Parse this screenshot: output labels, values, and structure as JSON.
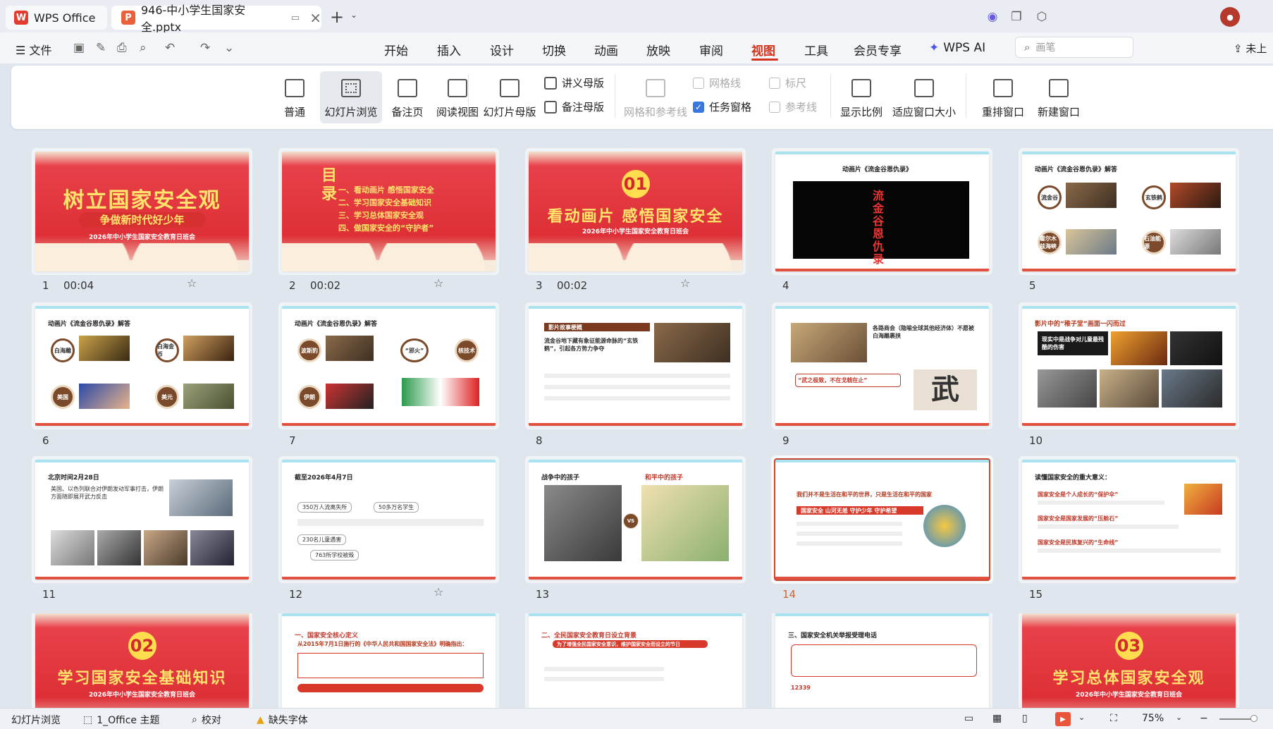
{
  "titlebar": {
    "home_tab": "WPS Office",
    "doc_tab": "946-中小学生国家安全.pptx"
  },
  "menubar": {
    "file": "文件",
    "tabs": [
      "开始",
      "插入",
      "设计",
      "切换",
      "动画",
      "放映",
      "审阅",
      "视图",
      "工具",
      "会员专享"
    ],
    "active_tab": "视图",
    "wps_ai": "WPS AI",
    "search_placeholder": "画笔",
    "cloud": "未上"
  },
  "ribbon": {
    "normal": "普通",
    "slide_sorter": "幻灯片浏览",
    "notes_page": "备注页",
    "reading_view": "阅读视图",
    "slide_master": "幻灯片母版",
    "handout_master": "讲义母版",
    "notes_master": "备注母版",
    "grid_guides": "网格和参考线",
    "gridlines": "网格线",
    "ruler": "标尺",
    "task_pane": "任务窗格",
    "guides": "参考线",
    "zoom": "显示比例",
    "fit_window": "适应窗口大小",
    "arrange": "重排窗口",
    "new_window": "新建窗口"
  },
  "slides": [
    {
      "n": "1",
      "time": "00:04",
      "title": "树立国家安全观",
      "subtitle": "争做新时代好少年",
      "caption": "2026年中小学生国家安全教育日班会"
    },
    {
      "n": "2",
      "time": "00:02",
      "big": "目录",
      "items": [
        "一、看动画片 感悟国家安全",
        "二、学习国家安全基础知识",
        "三、学习总体国家安全观",
        "四、做国家安全的“守护者”"
      ]
    },
    {
      "n": "3",
      "time": "00:02",
      "num": "01",
      "title": "看动画片 感悟国家安全",
      "caption": "2026年中小学生国家安全教育日班会"
    },
    {
      "n": "4",
      "title": "动画片《流金谷恩仇录》",
      "label": "流金谷恩仇录"
    },
    {
      "n": "5",
      "title": "动画片《流金谷恩仇录》解答",
      "c1": "流金谷",
      "c2": "霍尔木兹海峡",
      "c3": "玄铁鹤",
      "c4": "石油能源"
    },
    {
      "n": "6",
      "title": "动画片《流金谷恩仇录》解答",
      "c1": "白海雕",
      "c2": "美国",
      "c3": "白海金币",
      "c4": "美元"
    },
    {
      "n": "7",
      "title": "动画片《流金谷恩仇录》解答",
      "c1": "波斯豹",
      "c2": "伊朗",
      "c3": "“邪火”",
      "c4": "核技术"
    },
    {
      "n": "8",
      "title": "影片故事梗概",
      "body": "流金谷地下藏有象征能源命脉的“玄铁鹤”，引起各方势力争夺"
    },
    {
      "n": "9",
      "title": "各路商会（隐喻全球其他经济体）不愿被白海雕裹挟",
      "quote": "“武之极致，不在戈戟在止”",
      "char": "武"
    },
    {
      "n": "10",
      "title": "影片中的“稚子堂”画面一闪而过",
      "banner": "现实中是战争对儿童最残酷的伤害"
    },
    {
      "n": "11",
      "title": "北京时间2月28日",
      "body": "美国、以色列联合对伊朗发动军事打击，伊朗方面随即展开武力反击"
    },
    {
      "n": "12",
      "title": "截至2026年4月7日",
      "stats": [
        "350万人流离失所",
        "50多万名学生",
        "230名儿童遇害",
        "763所学校被毁"
      ]
    },
    {
      "n": "13",
      "left": "战争中的孩子",
      "right": "和平中的孩子",
      "vs": "VS"
    },
    {
      "n": "14",
      "title": "我们并不是生活在和平的世界，只是生活在和平的国家",
      "banner": "国家安全 山河无恙 守护少年 守护希望"
    },
    {
      "n": "15",
      "title": "读懂国家安全的重大意义：",
      "p1": "国家安全是个人成长的“保护伞”",
      "p2": "国家安全是国家发展的“压舱石”",
      "p3": "国家安全是民族复兴的“生命线”"
    },
    {
      "n": "16",
      "num": "02",
      "title": "学习国家安全基础知识",
      "caption": "2026年中小学生国家安全教育日班会"
    },
    {
      "n": "17",
      "title": "一、国家安全核心定义",
      "sub": "从2015年7月1日施行的《中华人民共和国国家安全法》明确指出："
    },
    {
      "n": "18",
      "title": "二、全民国家安全教育日设立背景",
      "banner": "为了增强全民国家安全意识，维护国家安全而设立的节日"
    },
    {
      "n": "19",
      "title": "三、国家安全机关举报受理电话",
      "phone": "12339"
    },
    {
      "n": "20",
      "num": "03",
      "title": "学习总体国家安全观",
      "caption": "2026年中小学生国家安全教育日班会"
    }
  ],
  "statusbar": {
    "mode": "幻灯片浏览",
    "theme": "1_Office 主题",
    "proof": "校对",
    "missing_font": "缺失字体",
    "zoom": "75%"
  },
  "colors": {
    "accent": "#d6331f",
    "slide_red": "#de2f36",
    "selected": "#c9472f"
  }
}
